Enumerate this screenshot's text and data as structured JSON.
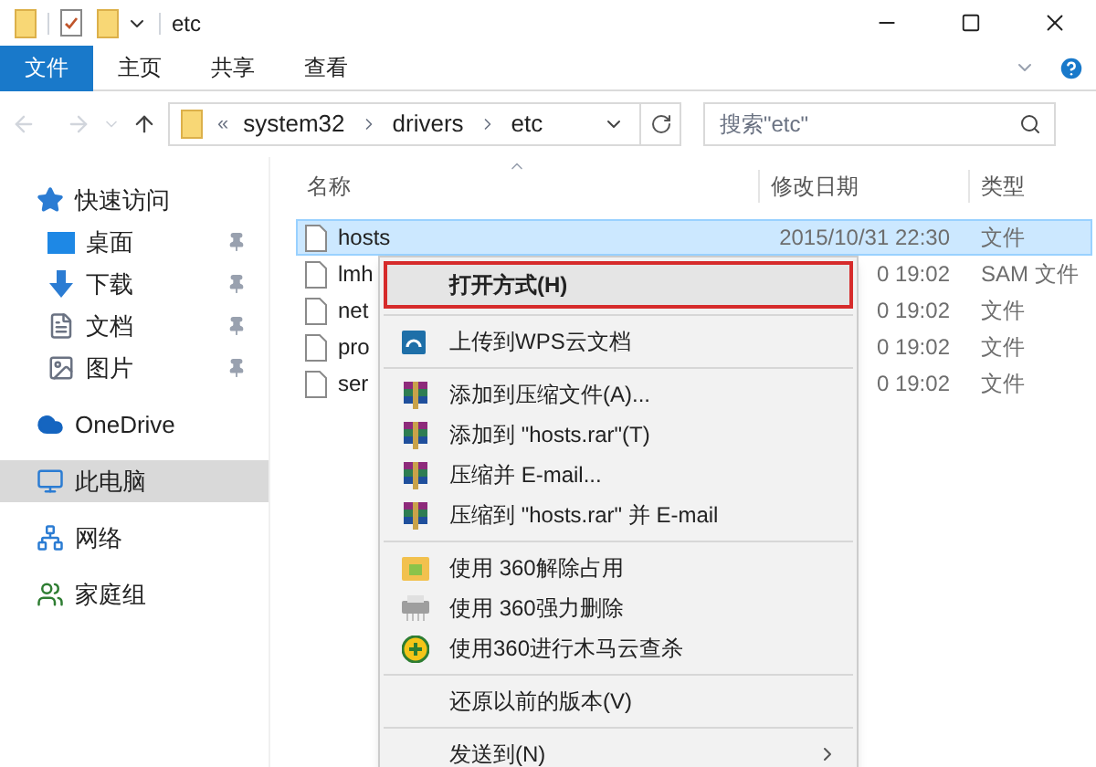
{
  "window": {
    "title": "etc"
  },
  "ribbon_tabs": [
    {
      "label": "文件",
      "selected": true
    },
    {
      "label": "主页",
      "selected": false
    },
    {
      "label": "共享",
      "selected": false
    },
    {
      "label": "查看",
      "selected": false
    }
  ],
  "address": {
    "overflow": "«",
    "segments": [
      "system32",
      "drivers",
      "etc"
    ]
  },
  "search": {
    "placeholder": "搜索\"etc\""
  },
  "sidebar": {
    "items": [
      {
        "label": "快速访问",
        "kind": "star",
        "selected": false,
        "children": [
          {
            "label": "桌面",
            "kind": "desktop",
            "pinned": true,
            "selected": false
          },
          {
            "label": "下载",
            "kind": "download",
            "pinned": true,
            "selected": false
          },
          {
            "label": "文档",
            "kind": "document",
            "pinned": true,
            "selected": false
          },
          {
            "label": "图片",
            "kind": "picture",
            "pinned": true,
            "selected": false
          }
        ]
      },
      {
        "label": "OneDrive",
        "kind": "cloud",
        "selected": false
      },
      {
        "label": "此电脑",
        "kind": "computer",
        "selected": true
      },
      {
        "label": "网络",
        "kind": "network",
        "selected": false
      },
      {
        "label": "家庭组",
        "kind": "homegroup",
        "selected": false
      }
    ]
  },
  "table": {
    "columns": [
      "名称",
      "修改日期",
      "类型"
    ],
    "rows": [
      {
        "name": "hosts",
        "date": "2015/10/31 22:30",
        "type": "文件",
        "selected": true
      },
      {
        "name": "lmh",
        "date": "0 19:02",
        "type": "SAM 文件",
        "selected": false
      },
      {
        "name": "net",
        "date": "0 19:02",
        "type": "文件",
        "selected": false
      },
      {
        "name": "pro",
        "date": "0 19:02",
        "type": "文件",
        "selected": false
      },
      {
        "name": "ser",
        "date": "0 19:02",
        "type": "文件",
        "selected": false
      }
    ]
  },
  "context_menu": {
    "groups": [
      [
        {
          "label": "打开方式(H)",
          "kind": "none",
          "bold": true,
          "highlighted": true
        }
      ],
      [
        {
          "label": "上传到WPS云文档",
          "kind": "wps",
          "bold": false,
          "highlighted": false
        }
      ],
      [
        {
          "label": "添加到压缩文件(A)...",
          "kind": "rar",
          "bold": false,
          "highlighted": false
        },
        {
          "label": "添加到 \"hosts.rar\"(T)",
          "kind": "rar",
          "bold": false,
          "highlighted": false
        },
        {
          "label": "压缩并 E-mail...",
          "kind": "rar",
          "bold": false,
          "highlighted": false
        },
        {
          "label": "压缩到 \"hosts.rar\" 并 E-mail",
          "kind": "rar",
          "bold": false,
          "highlighted": false
        }
      ],
      [
        {
          "label": "使用 360解除占用",
          "kind": "unlock",
          "bold": false,
          "highlighted": false
        },
        {
          "label": "使用 360强力删除",
          "kind": "shred",
          "bold": false,
          "highlighted": false
        },
        {
          "label": "使用360进行木马云查杀",
          "kind": "scan",
          "bold": false,
          "highlighted": false
        }
      ],
      [
        {
          "label": "还原以前的版本(V)",
          "kind": "none",
          "bold": false,
          "highlighted": false
        }
      ],
      [
        {
          "label": "发送到(N)",
          "kind": "none",
          "bold": false,
          "highlighted": false,
          "submenu": true
        }
      ]
    ]
  }
}
